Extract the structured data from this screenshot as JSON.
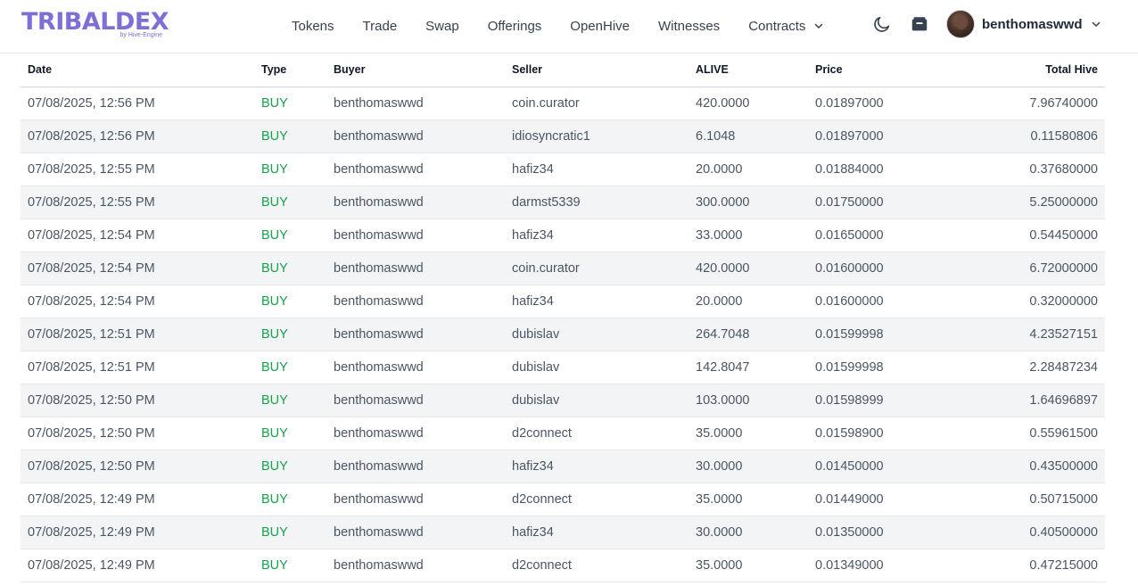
{
  "header": {
    "logo_text": "TRIBALDEX",
    "logo_sub": "by Hive-Engine",
    "nav": [
      "Tokens",
      "Trade",
      "Swap",
      "Offerings",
      "OpenHive",
      "Witnesses"
    ],
    "contracts_label": "Contracts",
    "username": "benthomaswwd",
    "icons": {
      "theme": "moon-icon",
      "wallet": "wallet-icon"
    },
    "accent_color": "#7c6fd6"
  },
  "table": {
    "columns": {
      "date": "Date",
      "type": "Type",
      "buyer": "Buyer",
      "seller": "Seller",
      "alive": "ALIVE",
      "price": "Price",
      "total": "Total Hive"
    },
    "rows": [
      {
        "date": "07/08/2025, 12:56 PM",
        "type": "BUY",
        "buyer": "benthomaswwd",
        "seller": "coin.curator",
        "alive": "420.0000",
        "price": "0.01897000",
        "total": "7.96740000"
      },
      {
        "date": "07/08/2025, 12:56 PM",
        "type": "BUY",
        "buyer": "benthomaswwd",
        "seller": "idiosyncratic1",
        "alive": "6.1048",
        "price": "0.01897000",
        "total": "0.11580806"
      },
      {
        "date": "07/08/2025, 12:55 PM",
        "type": "BUY",
        "buyer": "benthomaswwd",
        "seller": "hafiz34",
        "alive": "20.0000",
        "price": "0.01884000",
        "total": "0.37680000"
      },
      {
        "date": "07/08/2025, 12:55 PM",
        "type": "BUY",
        "buyer": "benthomaswwd",
        "seller": "darmst5339",
        "alive": "300.0000",
        "price": "0.01750000",
        "total": "5.25000000"
      },
      {
        "date": "07/08/2025, 12:54 PM",
        "type": "BUY",
        "buyer": "benthomaswwd",
        "seller": "hafiz34",
        "alive": "33.0000",
        "price": "0.01650000",
        "total": "0.54450000"
      },
      {
        "date": "07/08/2025, 12:54 PM",
        "type": "BUY",
        "buyer": "benthomaswwd",
        "seller": "coin.curator",
        "alive": "420.0000",
        "price": "0.01600000",
        "total": "6.72000000"
      },
      {
        "date": "07/08/2025, 12:54 PM",
        "type": "BUY",
        "buyer": "benthomaswwd",
        "seller": "hafiz34",
        "alive": "20.0000",
        "price": "0.01600000",
        "total": "0.32000000"
      },
      {
        "date": "07/08/2025, 12:51 PM",
        "type": "BUY",
        "buyer": "benthomaswwd",
        "seller": "dubislav",
        "alive": "264.7048",
        "price": "0.01599998",
        "total": "4.23527151"
      },
      {
        "date": "07/08/2025, 12:51 PM",
        "type": "BUY",
        "buyer": "benthomaswwd",
        "seller": "dubislav",
        "alive": "142.8047",
        "price": "0.01599998",
        "total": "2.28487234"
      },
      {
        "date": "07/08/2025, 12:50 PM",
        "type": "BUY",
        "buyer": "benthomaswwd",
        "seller": "dubislav",
        "alive": "103.0000",
        "price": "0.01598999",
        "total": "1.64696897"
      },
      {
        "date": "07/08/2025, 12:50 PM",
        "type": "BUY",
        "buyer": "benthomaswwd",
        "seller": "d2connect",
        "alive": "35.0000",
        "price": "0.01598900",
        "total": "0.55961500"
      },
      {
        "date": "07/08/2025, 12:50 PM",
        "type": "BUY",
        "buyer": "benthomaswwd",
        "seller": "hafiz34",
        "alive": "30.0000",
        "price": "0.01450000",
        "total": "0.43500000"
      },
      {
        "date": "07/08/2025, 12:49 PM",
        "type": "BUY",
        "buyer": "benthomaswwd",
        "seller": "d2connect",
        "alive": "35.0000",
        "price": "0.01449000",
        "total": "0.50715000"
      },
      {
        "date": "07/08/2025, 12:49 PM",
        "type": "BUY",
        "buyer": "benthomaswwd",
        "seller": "hafiz34",
        "alive": "30.0000",
        "price": "0.01350000",
        "total": "0.40500000"
      },
      {
        "date": "07/08/2025, 12:49 PM",
        "type": "BUY",
        "buyer": "benthomaswwd",
        "seller": "d2connect",
        "alive": "35.0000",
        "price": "0.01349000",
        "total": "0.47215000"
      }
    ],
    "buy_color": "#16a34a"
  }
}
